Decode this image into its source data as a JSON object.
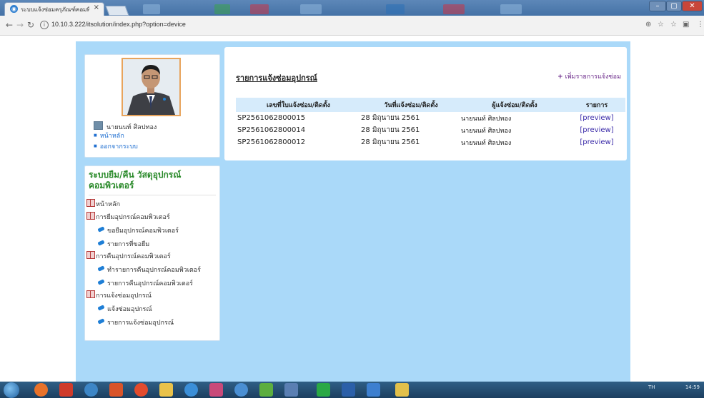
{
  "browser": {
    "tab_title": "ระบบแจ้งซ่อมครุภัณฑ์คอมพิวเตอร์",
    "tab_close": "×",
    "url": "10.10.3.222/itsolution/index.php?option=device",
    "window_controls": {
      "minimize": "–",
      "maximize": "▢",
      "close": "✕"
    }
  },
  "user": {
    "name": "นายนนท์ ศิลปทอง",
    "links": [
      {
        "label": "หน้าหลัก"
      },
      {
        "label": "ออกจากระบบ"
      }
    ]
  },
  "menu": {
    "title": "ระบบยืม/คืน วัสดุอุปกรณ์คอมพิวเตอร์",
    "items": [
      {
        "label": "หน้าหลัก",
        "type": "section"
      },
      {
        "label": "การยืมอุปกรณ์คอมพิวเตอร์",
        "type": "section"
      },
      {
        "label": "ขอยืมอุปกรณ์คอมพิวเตอร์",
        "type": "sub"
      },
      {
        "label": "รายการที่ขอยืม",
        "type": "sub"
      },
      {
        "label": "การคืนอุปกรณ์คอมพิวเตอร์",
        "type": "section"
      },
      {
        "label": "ทำรายการคืนอุปกรณ์คอมพิวเตอร์",
        "type": "sub"
      },
      {
        "label": "รายการคืนอุปกรณ์คอมพิวเตอร์",
        "type": "sub"
      },
      {
        "label": "การแจ้งซ่อมอุปกรณ์",
        "type": "section"
      },
      {
        "label": "แจ้งซ่อมอุปกรณ์",
        "type": "sub"
      },
      {
        "label": "รายการแจ้งซ่อมอุปกรณ์",
        "type": "sub"
      }
    ]
  },
  "main": {
    "title": "รายการแจ้งซ่อมอุปกรณ์",
    "add_label": "เพิ่มรายการแจ้งซ่อม",
    "table": {
      "headers": [
        "เลขที่ใบแจ้งซ่อม/ติดตั้ง",
        "วันที่แจ้งซ่อม/ติดตั้ง",
        "ผู้แจ้งซ่อม/ติดตั้ง",
        "รายการ"
      ],
      "rows": [
        {
          "code": "SP2561062800015",
          "date": "28 มิถุนายน 2561",
          "reporter": "นายนนท์ ศิลปทอง",
          "action": "[preview]"
        },
        {
          "code": "SP2561062800014",
          "date": "28 มิถุนายน 2561",
          "reporter": "นายนนท์ ศิลปทอง",
          "action": "[preview]"
        },
        {
          "code": "SP2561062800012",
          "date": "28 มิถุนายน 2561",
          "reporter": "นายนนท์ ศิลปทอง",
          "action": "[preview]"
        }
      ]
    }
  },
  "taskbar": {
    "lang": "TH",
    "time": "14:59"
  }
}
